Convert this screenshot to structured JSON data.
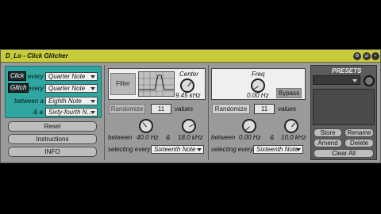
{
  "window": {
    "title": "D_Lo - Click Glitcher"
  },
  "titlebar_icons": [
    "gear-icon",
    "hotswap-icon",
    "save-icon"
  ],
  "triggers": {
    "click_label": "Click",
    "glitch_label": "Glitch",
    "every_label": "every",
    "click_every": "Quarter Note",
    "glitch_every": "Quarter Note",
    "between_label": "between a",
    "between_value": "Eighth Note",
    "and_label": "& a",
    "and_value": "Sixty-fourth N..."
  },
  "left_buttons": {
    "reset": "Reset",
    "instructions": "Instructions",
    "info": "INFO"
  },
  "filter_section": {
    "filter_button": "Filter",
    "center_label": "Center",
    "center_value": "9.45 kHz",
    "randomize": "Randomize",
    "values_count": "11",
    "values_label": "values",
    "between_label": "between",
    "low_value": "40.0 Hz",
    "amp": "&",
    "high_value": "18.0 kHz",
    "selecting_label": "selecting every:",
    "selecting_value": "Sixteenth Note"
  },
  "freq_section": {
    "freq_label": "Freq",
    "freq_value": "0.00 Hz",
    "bypass": "Bypass",
    "randomize": "Randomize",
    "values_count": "11",
    "values_label": "values",
    "between_label": "between",
    "low_value": "0.00 Hz",
    "amp": "&",
    "high_value": "10.0 kHz",
    "selecting_label": "selecting every:",
    "selecting_value": "Sixteenth Note"
  },
  "presets": {
    "title": "PRESETS",
    "store": "Store",
    "rename": "Rename",
    "amend": "Amend",
    "delete": "Delete",
    "clear_all": "Clear All"
  },
  "colors": {
    "titlebar": "#c9cc3a",
    "teal": "#2fa7a0",
    "device": "#9a9a9a"
  }
}
